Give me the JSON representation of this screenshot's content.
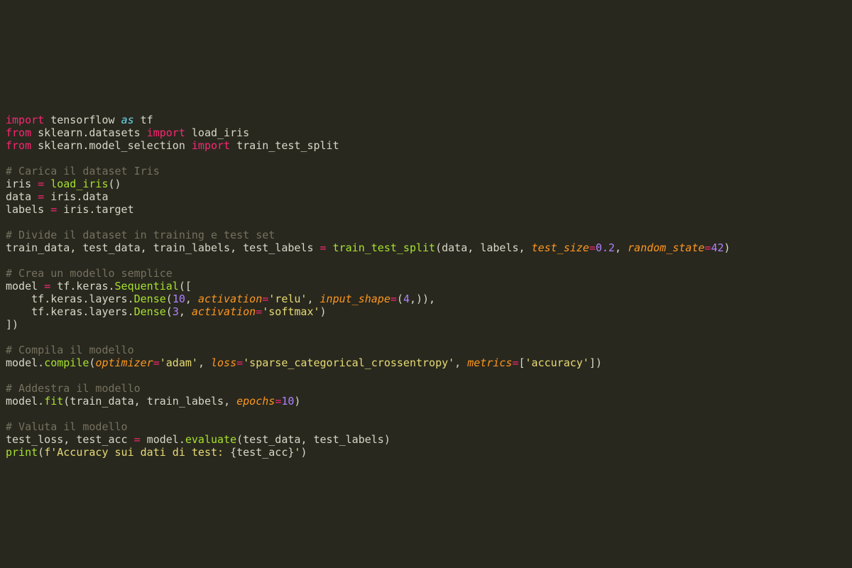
{
  "colors": {
    "background": "#29281f",
    "default": "#d7d8c8",
    "keyword": "#f92672",
    "keyword2": "#66d9ef",
    "number": "#ae81ff",
    "string": "#e6db74",
    "comment": "#75715e",
    "function": "#a6e22e",
    "argname": "#fd971f"
  },
  "code_lines": [
    [
      {
        "c": "kw",
        "t": "import"
      },
      {
        "c": "nm",
        "t": " tensorflow "
      },
      {
        "c": "kw2",
        "t": "as"
      },
      {
        "c": "nm",
        "t": " tf"
      }
    ],
    [
      {
        "c": "kw",
        "t": "from"
      },
      {
        "c": "nm",
        "t": " sklearn"
      },
      {
        "c": "pn",
        "t": "."
      },
      {
        "c": "nm",
        "t": "datasets "
      },
      {
        "c": "kw",
        "t": "import"
      },
      {
        "c": "nm",
        "t": " load_iris"
      }
    ],
    [
      {
        "c": "kw",
        "t": "from"
      },
      {
        "c": "nm",
        "t": " sklearn"
      },
      {
        "c": "pn",
        "t": "."
      },
      {
        "c": "nm",
        "t": "model_selection "
      },
      {
        "c": "kw",
        "t": "import"
      },
      {
        "c": "nm",
        "t": " train_test_split"
      }
    ],
    [],
    [
      {
        "c": "cm",
        "t": "# Carica il dataset Iris"
      }
    ],
    [
      {
        "c": "nm",
        "t": "iris "
      },
      {
        "c": "op",
        "t": "="
      },
      {
        "c": "nm",
        "t": " "
      },
      {
        "c": "fn",
        "t": "load_iris"
      },
      {
        "c": "pn",
        "t": "()"
      }
    ],
    [
      {
        "c": "nm",
        "t": "data "
      },
      {
        "c": "op",
        "t": "="
      },
      {
        "c": "nm",
        "t": " iris"
      },
      {
        "c": "pn",
        "t": "."
      },
      {
        "c": "nm",
        "t": "data"
      }
    ],
    [
      {
        "c": "nm",
        "t": "labels "
      },
      {
        "c": "op",
        "t": "="
      },
      {
        "c": "nm",
        "t": " iris"
      },
      {
        "c": "pn",
        "t": "."
      },
      {
        "c": "nm",
        "t": "target"
      }
    ],
    [],
    [
      {
        "c": "cm",
        "t": "# Divide il dataset in training e test set"
      }
    ],
    [
      {
        "c": "nm",
        "t": "train_data"
      },
      {
        "c": "pn",
        "t": ", "
      },
      {
        "c": "nm",
        "t": "test_data"
      },
      {
        "c": "pn",
        "t": ", "
      },
      {
        "c": "nm",
        "t": "train_labels"
      },
      {
        "c": "pn",
        "t": ", "
      },
      {
        "c": "nm",
        "t": "test_labels "
      },
      {
        "c": "op",
        "t": "="
      },
      {
        "c": "nm",
        "t": " "
      },
      {
        "c": "fn",
        "t": "train_test_split"
      },
      {
        "c": "pn",
        "t": "("
      },
      {
        "c": "nm",
        "t": "data"
      },
      {
        "c": "pn",
        "t": ", "
      },
      {
        "c": "nm",
        "t": "labels"
      },
      {
        "c": "pn",
        "t": ", "
      },
      {
        "c": "arg",
        "t": "test_size"
      },
      {
        "c": "op",
        "t": "="
      },
      {
        "c": "num",
        "t": "0.2"
      },
      {
        "c": "pn",
        "t": ", "
      },
      {
        "c": "arg",
        "t": "random_state"
      },
      {
        "c": "op",
        "t": "="
      },
      {
        "c": "num",
        "t": "42"
      },
      {
        "c": "pn",
        "t": ")"
      }
    ],
    [],
    [
      {
        "c": "cm",
        "t": "# Crea un modello semplice"
      }
    ],
    [
      {
        "c": "nm",
        "t": "model "
      },
      {
        "c": "op",
        "t": "="
      },
      {
        "c": "nm",
        "t": " tf"
      },
      {
        "c": "pn",
        "t": "."
      },
      {
        "c": "nm",
        "t": "keras"
      },
      {
        "c": "pn",
        "t": "."
      },
      {
        "c": "fn",
        "t": "Sequential"
      },
      {
        "c": "pn",
        "t": "(["
      }
    ],
    [
      {
        "c": "nm",
        "t": "    tf"
      },
      {
        "c": "pn",
        "t": "."
      },
      {
        "c": "nm",
        "t": "keras"
      },
      {
        "c": "pn",
        "t": "."
      },
      {
        "c": "nm",
        "t": "layers"
      },
      {
        "c": "pn",
        "t": "."
      },
      {
        "c": "fn",
        "t": "Dense"
      },
      {
        "c": "pn",
        "t": "("
      },
      {
        "c": "num",
        "t": "10"
      },
      {
        "c": "pn",
        "t": ", "
      },
      {
        "c": "arg",
        "t": "activation"
      },
      {
        "c": "op",
        "t": "="
      },
      {
        "c": "str",
        "t": "'relu'"
      },
      {
        "c": "pn",
        "t": ", "
      },
      {
        "c": "arg",
        "t": "input_shape"
      },
      {
        "c": "op",
        "t": "="
      },
      {
        "c": "pn",
        "t": "("
      },
      {
        "c": "num",
        "t": "4"
      },
      {
        "c": "pn",
        "t": ",)),"
      }
    ],
    [
      {
        "c": "nm",
        "t": "    tf"
      },
      {
        "c": "pn",
        "t": "."
      },
      {
        "c": "nm",
        "t": "keras"
      },
      {
        "c": "pn",
        "t": "."
      },
      {
        "c": "nm",
        "t": "layers"
      },
      {
        "c": "pn",
        "t": "."
      },
      {
        "c": "fn",
        "t": "Dense"
      },
      {
        "c": "pn",
        "t": "("
      },
      {
        "c": "num",
        "t": "3"
      },
      {
        "c": "pn",
        "t": ", "
      },
      {
        "c": "arg",
        "t": "activation"
      },
      {
        "c": "op",
        "t": "="
      },
      {
        "c": "str",
        "t": "'softmax'"
      },
      {
        "c": "pn",
        "t": ")"
      }
    ],
    [
      {
        "c": "pn",
        "t": "])"
      }
    ],
    [],
    [
      {
        "c": "cm",
        "t": "# Compila il modello"
      }
    ],
    [
      {
        "c": "nm",
        "t": "model"
      },
      {
        "c": "pn",
        "t": "."
      },
      {
        "c": "fn",
        "t": "compile"
      },
      {
        "c": "pn",
        "t": "("
      },
      {
        "c": "arg",
        "t": "optimizer"
      },
      {
        "c": "op",
        "t": "="
      },
      {
        "c": "str",
        "t": "'adam'"
      },
      {
        "c": "pn",
        "t": ", "
      },
      {
        "c": "arg",
        "t": "loss"
      },
      {
        "c": "op",
        "t": "="
      },
      {
        "c": "str",
        "t": "'sparse_categorical_crossentropy'"
      },
      {
        "c": "pn",
        "t": ", "
      },
      {
        "c": "arg",
        "t": "metrics"
      },
      {
        "c": "op",
        "t": "="
      },
      {
        "c": "pn",
        "t": "["
      },
      {
        "c": "str",
        "t": "'accuracy'"
      },
      {
        "c": "pn",
        "t": "])"
      }
    ],
    [],
    [
      {
        "c": "cm",
        "t": "# Addestra il modello"
      }
    ],
    [
      {
        "c": "nm",
        "t": "model"
      },
      {
        "c": "pn",
        "t": "."
      },
      {
        "c": "fn",
        "t": "fit"
      },
      {
        "c": "pn",
        "t": "("
      },
      {
        "c": "nm",
        "t": "train_data"
      },
      {
        "c": "pn",
        "t": ", "
      },
      {
        "c": "nm",
        "t": "train_labels"
      },
      {
        "c": "pn",
        "t": ", "
      },
      {
        "c": "arg",
        "t": "epochs"
      },
      {
        "c": "op",
        "t": "="
      },
      {
        "c": "num",
        "t": "10"
      },
      {
        "c": "pn",
        "t": ")"
      }
    ],
    [],
    [
      {
        "c": "cm",
        "t": "# Valuta il modello"
      }
    ],
    [
      {
        "c": "nm",
        "t": "test_loss"
      },
      {
        "c": "pn",
        "t": ", "
      },
      {
        "c": "nm",
        "t": "test_acc "
      },
      {
        "c": "op",
        "t": "="
      },
      {
        "c": "nm",
        "t": " model"
      },
      {
        "c": "pn",
        "t": "."
      },
      {
        "c": "fn",
        "t": "evaluate"
      },
      {
        "c": "pn",
        "t": "("
      },
      {
        "c": "nm",
        "t": "test_data"
      },
      {
        "c": "pn",
        "t": ", "
      },
      {
        "c": "nm",
        "t": "test_labels"
      },
      {
        "c": "pn",
        "t": ")"
      }
    ],
    [
      {
        "c": "fn",
        "t": "print"
      },
      {
        "c": "pn",
        "t": "("
      },
      {
        "c": "str",
        "t": "f'Accuracy sui dati di test: "
      },
      {
        "c": "pn",
        "t": "{"
      },
      {
        "c": "nm",
        "t": "test_acc"
      },
      {
        "c": "pn",
        "t": "}"
      },
      {
        "c": "str",
        "t": "'"
      },
      {
        "c": "pn",
        "t": ")"
      }
    ]
  ]
}
